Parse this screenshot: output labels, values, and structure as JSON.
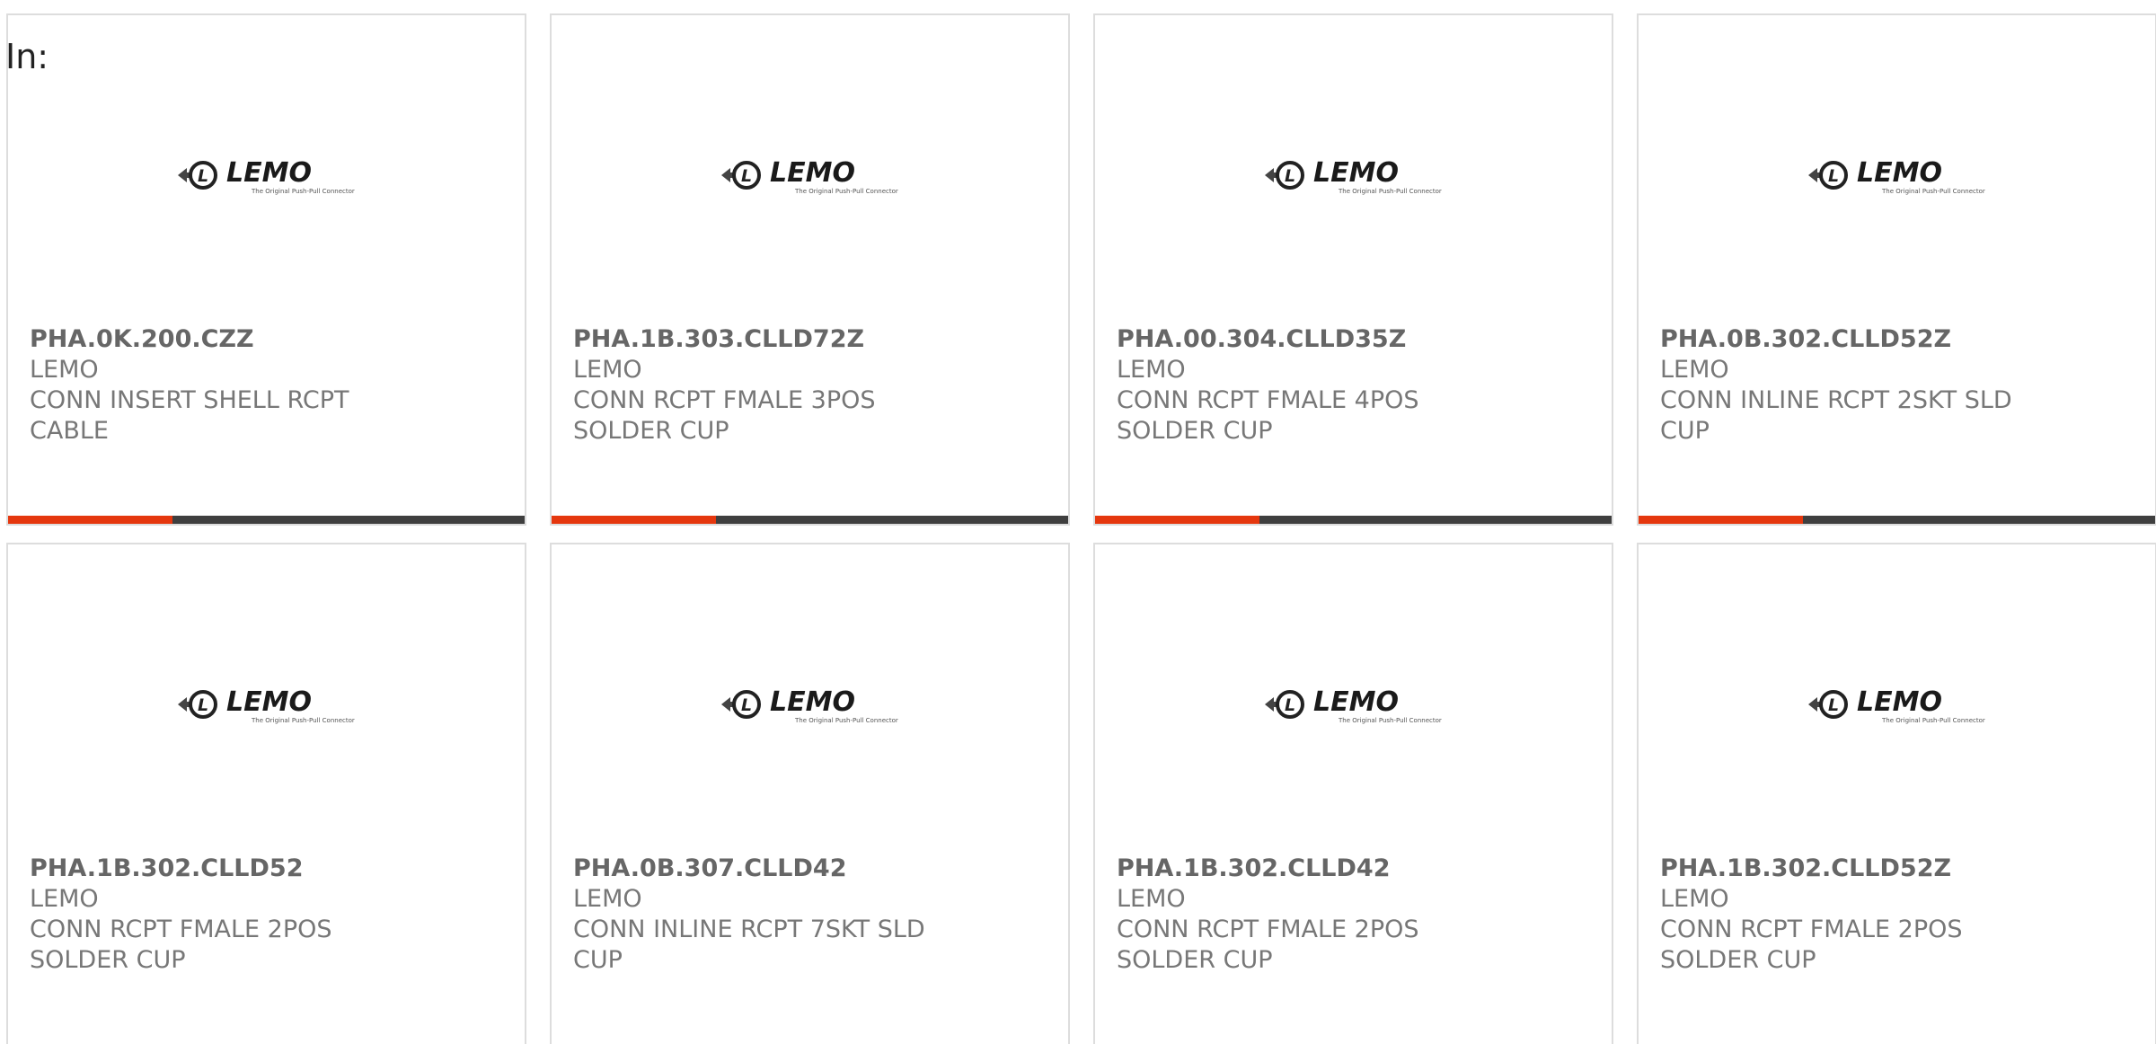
{
  "filter": {
    "label": "In:"
  },
  "brand": {
    "logo_text": "LEMO",
    "logo_tagline": "The Original Push-Pull Connector",
    "accent_color": "#e5370e"
  },
  "products": [
    {
      "part_number": "PHA.0K.200.CZZ",
      "manufacturer": "LEMO",
      "description_line1": "CONN INSERT SHELL RCPT",
      "description_line2": "CABLE"
    },
    {
      "part_number": "PHA.1B.303.CLLD72Z",
      "manufacturer": "LEMO",
      "description_line1": "CONN RCPT FMALE 3POS",
      "description_line2": "SOLDER CUP"
    },
    {
      "part_number": "PHA.00.304.CLLD35Z",
      "manufacturer": "LEMO",
      "description_line1": "CONN RCPT FMALE 4POS",
      "description_line2": "SOLDER CUP"
    },
    {
      "part_number": "PHA.0B.302.CLLD52Z",
      "manufacturer": "LEMO",
      "description_line1": "CONN INLINE RCPT 2SKT SLD",
      "description_line2": "CUP"
    },
    {
      "part_number": "PHA.1B.302.CLLD52",
      "manufacturer": "LEMO",
      "description_line1": "CONN RCPT FMALE 2POS",
      "description_line2": "SOLDER CUP"
    },
    {
      "part_number": "PHA.0B.307.CLLD42",
      "manufacturer": "LEMO",
      "description_line1": "CONN INLINE RCPT 7SKT SLD",
      "description_line2": "CUP"
    },
    {
      "part_number": "PHA.1B.302.CLLD42",
      "manufacturer": "LEMO",
      "description_line1": "CONN RCPT FMALE 2POS",
      "description_line2": "SOLDER CUP"
    },
    {
      "part_number": "PHA.1B.302.CLLD52Z",
      "manufacturer": "LEMO",
      "description_line1": "CONN RCPT FMALE 2POS",
      "description_line2": "SOLDER CUP"
    }
  ]
}
